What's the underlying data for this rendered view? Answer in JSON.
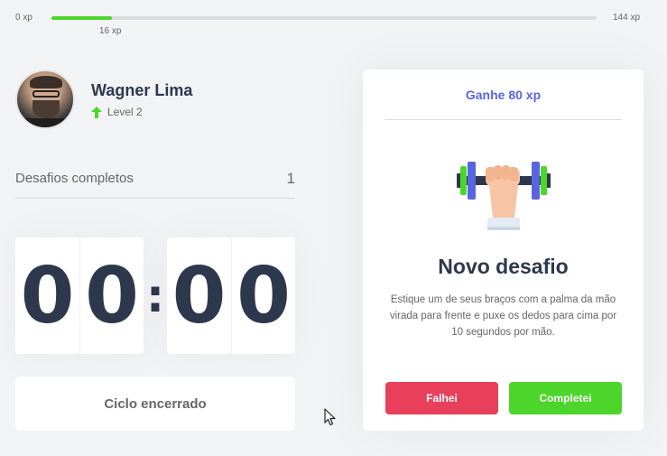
{
  "xp": {
    "min_label": "0 xp",
    "max_label": "144 xp",
    "current_label": "16 xp",
    "current": 16,
    "max": 144
  },
  "profile": {
    "name": "Wagner Lima",
    "level_label": "Level 2"
  },
  "stats": {
    "completed_label": "Desafios completos",
    "completed_count": "1"
  },
  "countdown": {
    "minutes": [
      "0",
      "0"
    ],
    "separator": ":",
    "seconds": [
      "0",
      "0"
    ]
  },
  "cycle_button_label": "Ciclo encerrado",
  "challenge": {
    "reward": "Ganhe 80 xp",
    "title": "Novo desafio",
    "description": "Estique um de seus braços com a palma da mão virada para frente e puxe os dedos para cima por 10 segundos por mão.",
    "icon": "dumbbell-hand-icon",
    "fail_label": "Falhei",
    "success_label": "Completei"
  },
  "colors": {
    "accent_blue": "#5965e0",
    "success_green": "#4cd62b",
    "danger_red": "#e83f5b",
    "title_dark": "#2e384d",
    "text_gray": "#666666",
    "background": "#f2f3f5"
  }
}
